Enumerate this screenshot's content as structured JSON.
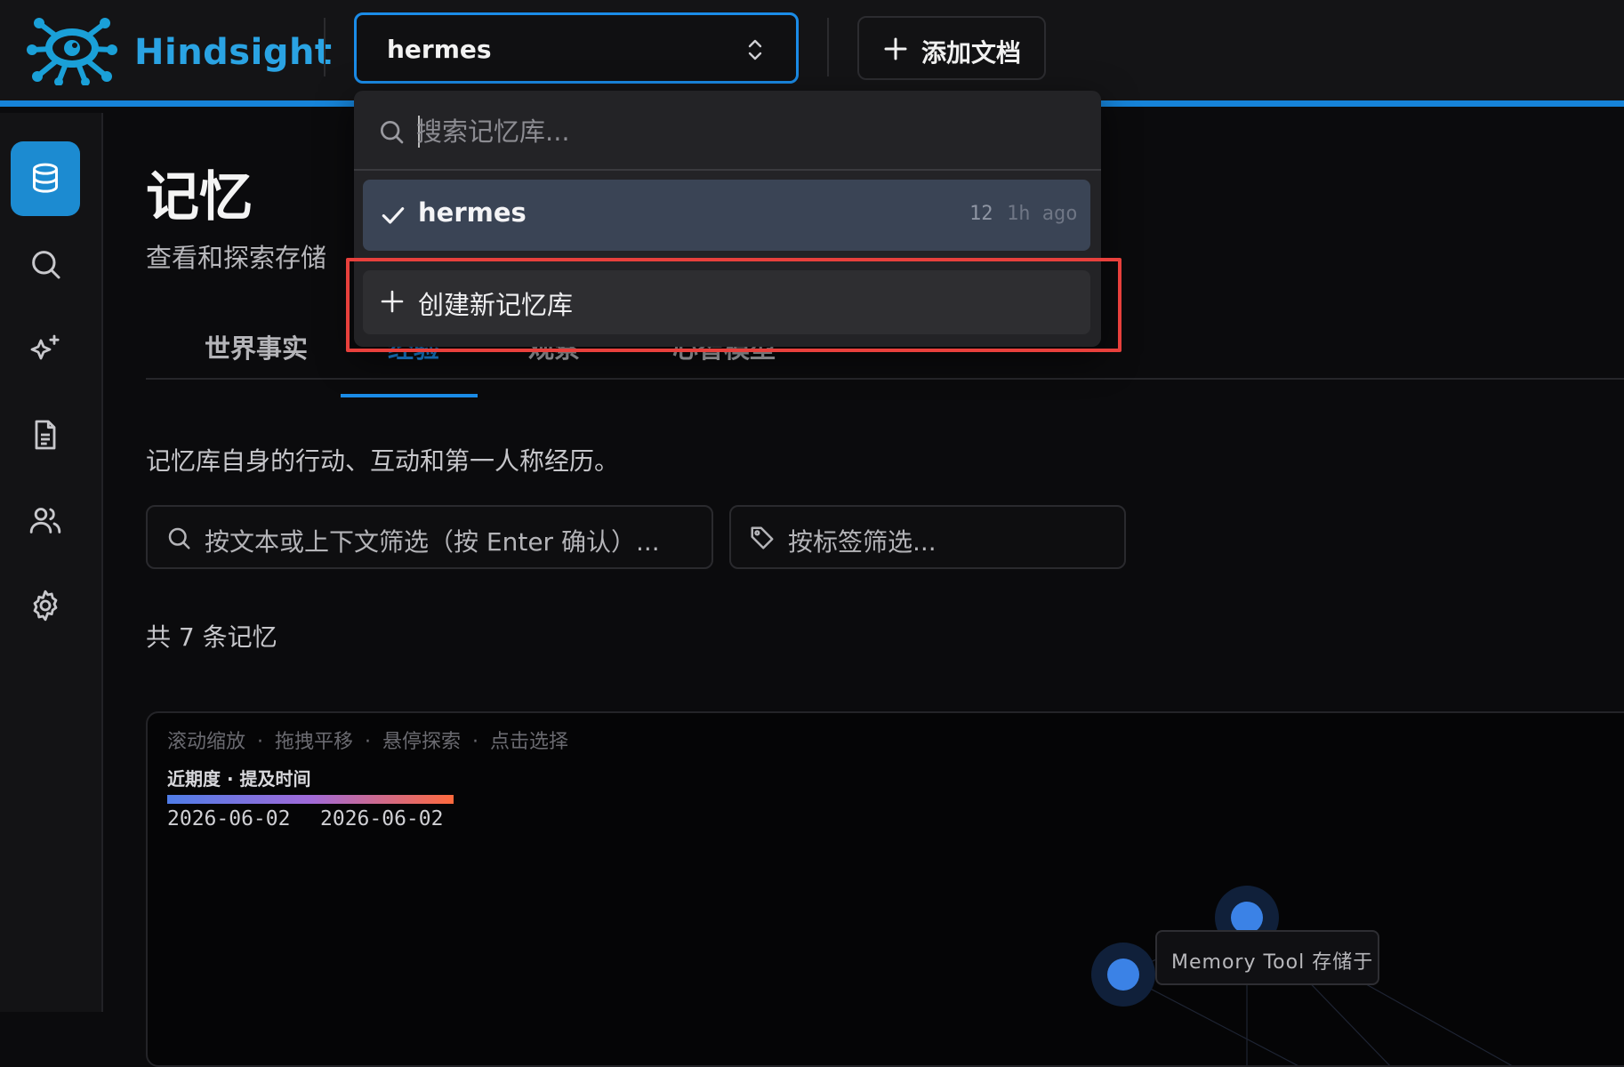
{
  "brand": {
    "name": "Hindsight",
    "color": "#2aa3e3"
  },
  "header": {
    "bank_select_value": "hermes",
    "add_document_label": "添加文档",
    "accent_color": "#1683d8"
  },
  "sidebar": {
    "items": [
      {
        "icon": "database-icon",
        "active": true
      },
      {
        "icon": "search-icon",
        "active": false
      },
      {
        "icon": "sparkles-icon",
        "active": false
      },
      {
        "icon": "document-icon",
        "active": false
      },
      {
        "icon": "users-icon",
        "active": false
      },
      {
        "icon": "gear-icon",
        "active": false
      }
    ]
  },
  "main": {
    "title": "记忆",
    "subtitle": "查看和探索存储",
    "tabs": [
      {
        "label": "世界事实"
      },
      {
        "label": "经验",
        "active": true
      },
      {
        "label": "观察"
      },
      {
        "label": "心智模型"
      }
    ],
    "description": "记忆库自身的行动、互动和第一人称经历。",
    "filter_text_placeholder": "按文本或上下文筛选（按 Enter 确认）...",
    "filter_tags_placeholder": "按标签筛选...",
    "count_text": "共 7 条记忆"
  },
  "graph": {
    "hints": "滚动缩放 · 拖拽平移 · 悬停探索 · 点击选择",
    "legend_title": "近期度 · 提及时间",
    "legend_start": "2026-06-02",
    "legend_end": "2026-06-02",
    "node_label": "Memory Tool 存储于",
    "node_color": "#3b82e6"
  },
  "dropdown": {
    "search_placeholder": "搜索记忆库...",
    "items": [
      {
        "name": "hermes",
        "count": "12",
        "time": "1h ago",
        "selected": true
      }
    ],
    "create_label": "创建新记忆库",
    "highlight_color": "#e8403c"
  }
}
